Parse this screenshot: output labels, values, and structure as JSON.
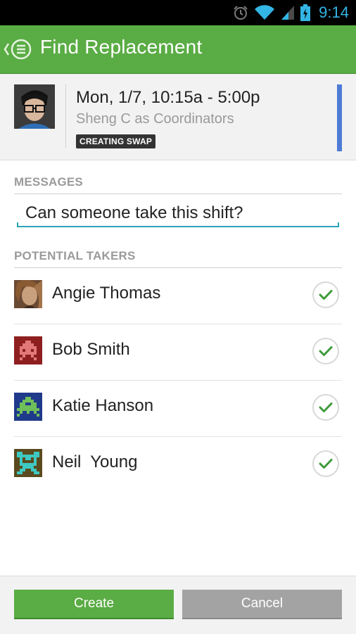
{
  "status_bar": {
    "time": "9:14",
    "icons": [
      "alarm-icon",
      "wifi-icon",
      "signal-icon",
      "battery-charging-icon"
    ]
  },
  "action_bar": {
    "title": "Find Replacement",
    "up_icon": "chevron-left-icon",
    "app_icon": "menu-list-icon",
    "color": "#5aac44"
  },
  "shift": {
    "when": "Mon, 1/7, 10:15a - 5:00p",
    "who": "Sheng C as Coordinators",
    "badge": "CREATING SWAP",
    "accent_color": "#4d7bd6"
  },
  "messages": {
    "section_title": "MESSAGES",
    "value": "Can someone take this shift?"
  },
  "takers": {
    "section_title": "POTENTIAL TAKERS",
    "items": [
      {
        "name": "Angie Thomas",
        "checked": true
      },
      {
        "name": "Bob Smith",
        "checked": true
      },
      {
        "name": "Katie Hanson",
        "checked": true
      },
      {
        "name": "Neil  Young",
        "checked": true
      }
    ]
  },
  "buttons": {
    "create": "Create",
    "cancel": "Cancel"
  }
}
